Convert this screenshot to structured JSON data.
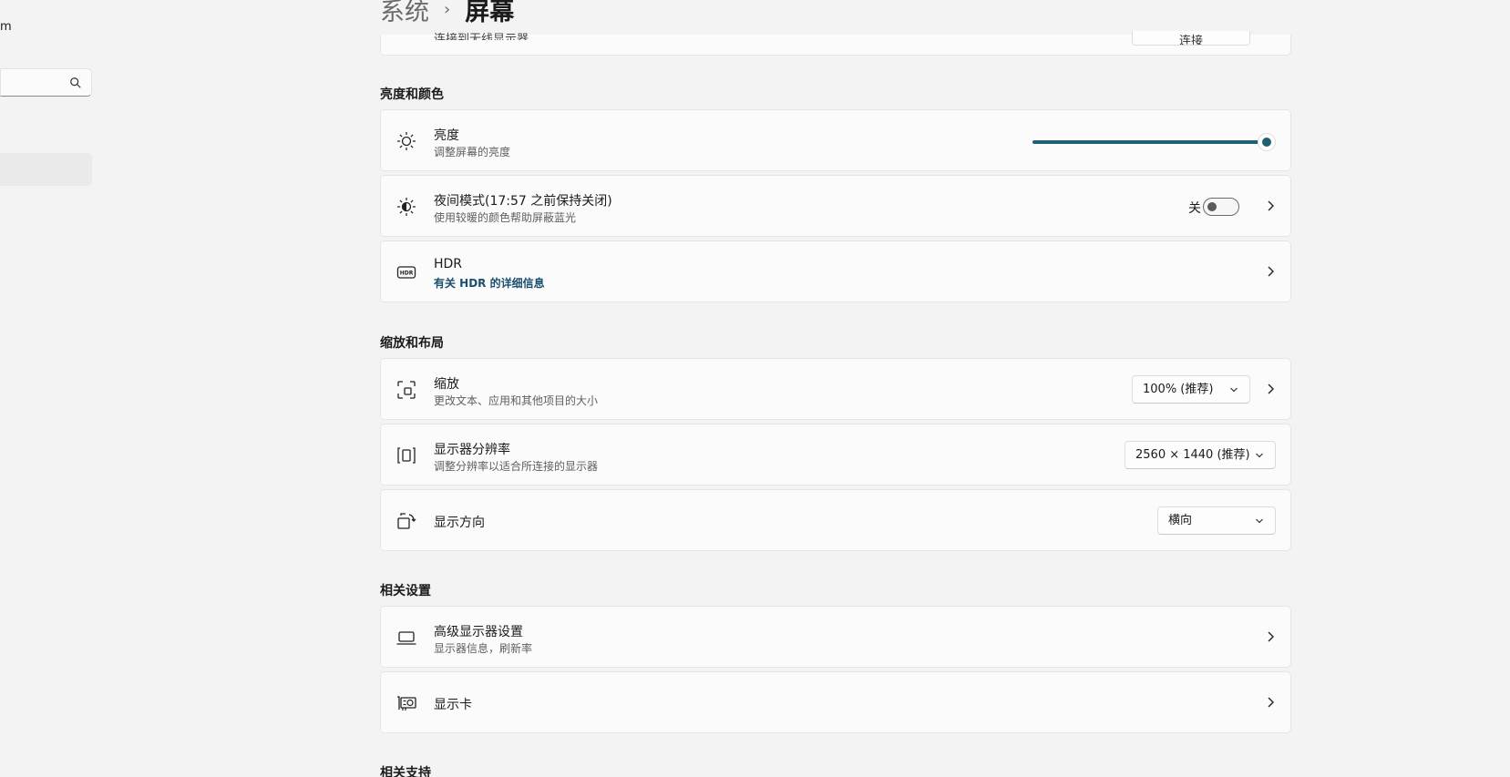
{
  "sidebar": {
    "user_fragment": "m",
    "search": {
      "placeholder": ""
    }
  },
  "breadcrumb": {
    "parent": "系统",
    "separator": "›",
    "current": "屏幕"
  },
  "top_partial": {
    "label": "连接到无线显示器",
    "button": "连接"
  },
  "sections": {
    "brightness_color": "亮度和颜色",
    "scale_layout": "缩放和布局",
    "related_settings": "相关设置",
    "related_support": "相关支持"
  },
  "brightness": {
    "title": "亮度",
    "subtitle": "调整屏幕的亮度",
    "value_percent": 100
  },
  "night_light": {
    "title": "夜间模式(17:57 之前保持关闭)",
    "subtitle": "使用较暖的颜色帮助屏蔽蓝光",
    "state_label": "关",
    "on": false
  },
  "hdr": {
    "title": "HDR",
    "link": "有关 HDR 的详细信息"
  },
  "scale": {
    "title": "缩放",
    "subtitle": "更改文本、应用和其他项目的大小",
    "selected": "100% (推荐)"
  },
  "resolution": {
    "title": "显示器分辨率",
    "subtitle": "调整分辨率以适合所连接的显示器",
    "selected": "2560 × 1440 (推荐)"
  },
  "orientation": {
    "title": "显示方向",
    "selected": "横向"
  },
  "advanced_display": {
    "title": "高级显示器设置",
    "subtitle": "显示器信息，刷新率"
  },
  "graphics": {
    "title": "显示卡"
  },
  "colors": {
    "accent": "#1d6172",
    "link": "#1a4f6e",
    "background": "#f3f3f3",
    "card": "#fbfbfb"
  }
}
